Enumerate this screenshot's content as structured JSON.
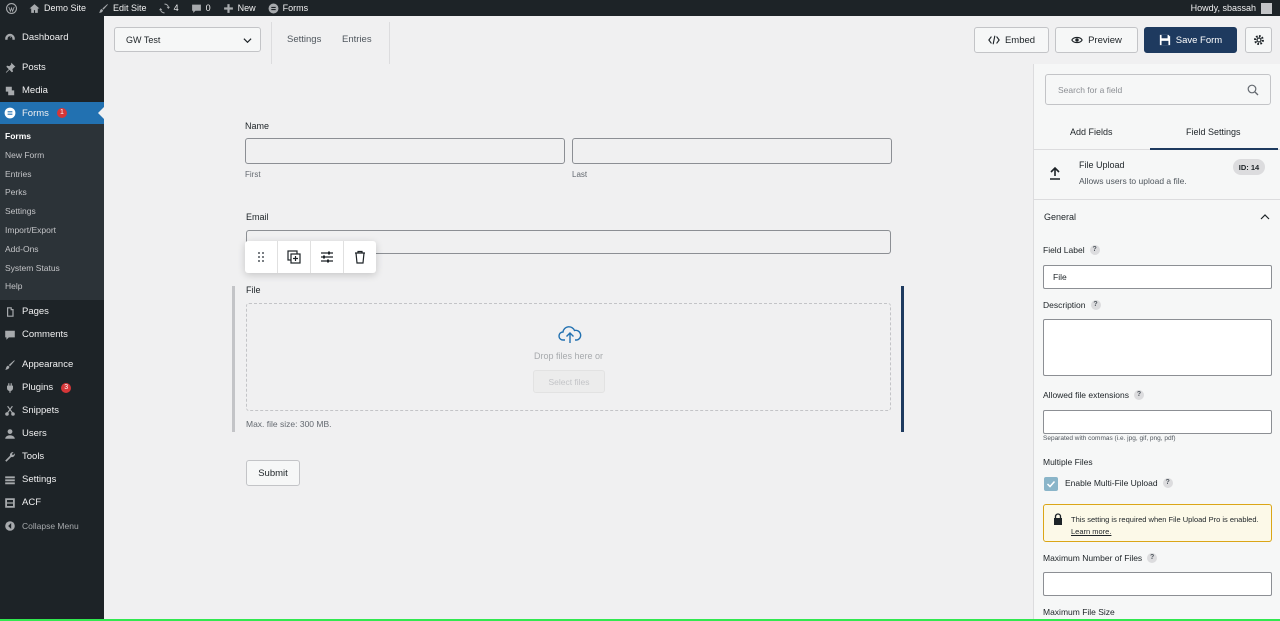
{
  "adminbar": {
    "site": "Demo Site",
    "edit_site": "Edit Site",
    "updates": "4",
    "comments": "0",
    "new": "New",
    "forms": "Forms",
    "howdy": "Howdy, sbassah"
  },
  "sidebar": {
    "dashboard": "Dashboard",
    "posts": "Posts",
    "media": "Media",
    "forms": "Forms",
    "forms_badge": "1",
    "submenu": [
      "Forms",
      "New Form",
      "Entries",
      "Perks",
      "Settings",
      "Import/Export",
      "Add-Ons",
      "System Status",
      "Help"
    ],
    "pages": "Pages",
    "comments": "Comments",
    "appearance": "Appearance",
    "plugins": "Plugins",
    "plugins_badge": "3",
    "snippets": "Snippets",
    "users": "Users",
    "tools": "Tools",
    "settings": "Settings",
    "acf": "ACF",
    "collapse": "Collapse Menu"
  },
  "topbar": {
    "form_name": "GW Test",
    "settings": "Settings",
    "entries": "Entries",
    "embed": "Embed",
    "preview": "Preview",
    "save": "Save Form"
  },
  "form": {
    "name_label": "Name",
    "first": "First",
    "last": "Last",
    "email_label": "Email",
    "file_label": "File",
    "drop_text": "Drop files here or",
    "select_files": "Select files",
    "max_size": "Max. file size: 300 MB.",
    "submit": "Submit"
  },
  "panel": {
    "search_placeholder": "Search for a field",
    "tab_add": "Add Fields",
    "tab_settings": "Field Settings",
    "field_type": "File Upload",
    "field_desc": "Allows users to upload a file.",
    "field_id": "ID: 14",
    "section": "General",
    "field_label_lbl": "Field Label",
    "field_label_val": "File",
    "description_lbl": "Description",
    "allowed_ext_lbl": "Allowed file extensions",
    "allowed_ext_hint": "Separated with commas (i.e. jpg, gif, png, pdf)",
    "multiple_files_lbl": "Multiple Files",
    "enable_multi": "Enable Multi-File Upload",
    "notice": "This setting is required when File Upload Pro is enabled.",
    "learn_more": "Learn more.",
    "max_files_lbl": "Maximum Number of Files",
    "max_size_lbl": "Maximum File Size"
  }
}
